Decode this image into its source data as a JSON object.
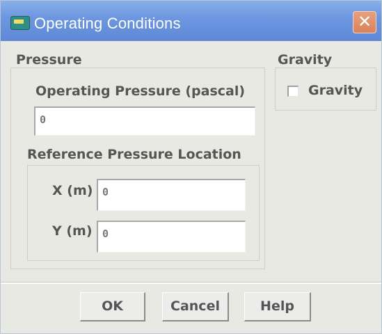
{
  "window": {
    "title": "Operating Conditions",
    "close_glyph": "✕",
    "icon": "app-window-icon"
  },
  "pressure": {
    "group_label": "Pressure",
    "operating_pressure_label": "Operating Pressure (pascal)",
    "operating_pressure_value": "0",
    "reference_location_label": "Reference Pressure Location",
    "x_label": "X (m)",
    "x_value": "0",
    "y_label": "Y (m)",
    "y_value": "0"
  },
  "gravity": {
    "group_label": "Gravity",
    "checkbox_label": "Gravity",
    "checked": false
  },
  "buttons": {
    "ok": "OK",
    "cancel": "Cancel",
    "help": "Help"
  },
  "colors": {
    "titlebar": "#6d97e0",
    "close_button": "#d9835c",
    "dialog_background": "#e9e9e3"
  }
}
